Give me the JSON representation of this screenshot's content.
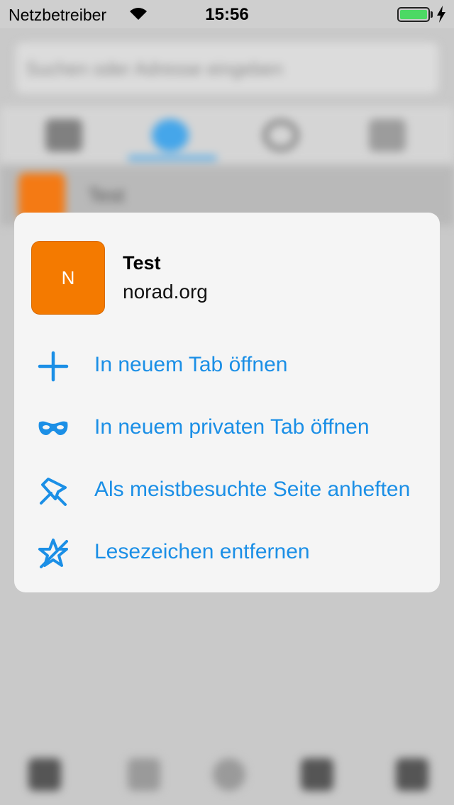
{
  "status_bar": {
    "carrier": "Netzbetreiber",
    "time": "15:56",
    "icons": [
      "wifi-icon",
      "battery-icon",
      "charging-bolt-icon"
    ]
  },
  "background": {
    "search_placeholder": "Suchen oder Adresse eingeben",
    "bookmark_title": "Test",
    "panel_icons": [
      "top-sites-icon",
      "bookmarks-icon",
      "history-icon",
      "reading-list-icon"
    ],
    "toolbar_icons": [
      "back-icon",
      "forward-icon",
      "reload-icon",
      "tabs-icon",
      "menu-icon"
    ]
  },
  "context_menu": {
    "site": {
      "favicon_letter": "N",
      "title": "Test",
      "url": "norad.org"
    },
    "items": [
      {
        "label": "In neuem Tab öffnen",
        "icon": "plus-icon"
      },
      {
        "label": "In neuem privaten Tab öffnen",
        "icon": "private-mask-icon"
      },
      {
        "label": "Als meistbesuchte Seite anheften",
        "icon": "pin-icon"
      },
      {
        "label": "Lesezeichen entfernen",
        "icon": "remove-bookmark-icon"
      }
    ]
  },
  "colors": {
    "accent": "#1b8fe6",
    "favicon_bg": "#f47a00",
    "card_bg": "#f5f5f5",
    "battery": "#4cd964"
  }
}
